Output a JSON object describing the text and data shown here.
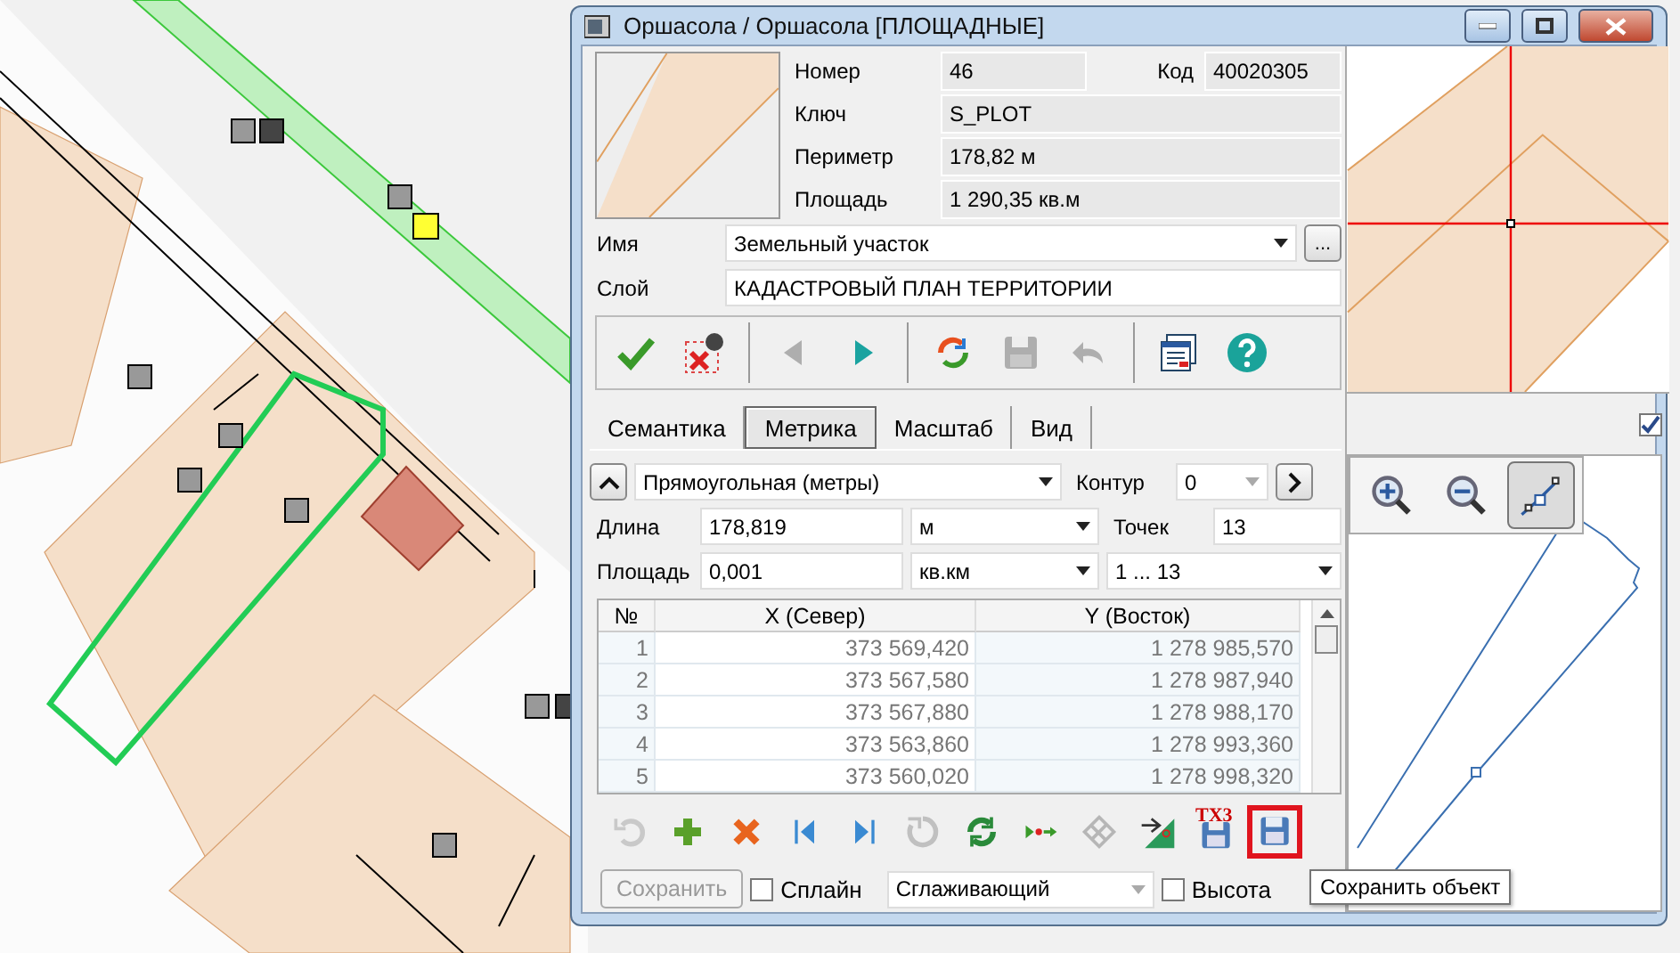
{
  "window": {
    "title": "Оршасола / Оршасола [ПЛОЩАДНЫЕ]"
  },
  "info": {
    "fields": [
      {
        "label": "Номер",
        "value": "46"
      },
      {
        "label": "Ключ",
        "value": "S_PLOT"
      },
      {
        "label": "Периметр",
        "value": "178,82 м"
      },
      {
        "label": "Площадь",
        "value": "1 290,35 кв.м"
      }
    ],
    "code": {
      "label": "Код",
      "value": "40020305"
    }
  },
  "name": {
    "label": "Имя",
    "value": "Земельный участок",
    "button": "..."
  },
  "layer": {
    "label": "Слой",
    "value": "КАДАСТРОВЫЙ ПЛАН ТЕРРИТОРИИ"
  },
  "toolbar": [
    [
      {
        "kind": "check",
        "disabled": false
      },
      {
        "kind": "cancel",
        "disabled": false
      }
    ],
    [
      {
        "kind": "prev",
        "disabled": true
      },
      {
        "kind": "next",
        "disabled": false
      }
    ],
    [
      {
        "kind": "refresh",
        "disabled": false
      },
      {
        "kind": "save",
        "disabled": true
      },
      {
        "kind": "undo",
        "disabled": true
      }
    ],
    [
      {
        "kind": "form",
        "disabled": false
      },
      {
        "kind": "help",
        "disabled": false
      }
    ]
  ],
  "tabs": [
    {
      "label": "Семантика",
      "selected": false
    },
    {
      "label": "Метрика",
      "selected": true
    },
    {
      "label": "Масштаб",
      "selected": false
    },
    {
      "label": "Вид",
      "selected": false
    }
  ],
  "tabs_checkbox": {
    "checked": true
  },
  "metric": {
    "system": "Прямоугольная (метры)",
    "contour": {
      "label": "Контур",
      "value": "0"
    },
    "length": {
      "label": "Длина",
      "value": "178,819",
      "unit": "м"
    },
    "points": {
      "label": "Точек",
      "value": "13"
    },
    "area": {
      "label": "Площадь",
      "value": "0,001",
      "unit": "кв.км"
    },
    "range": "1 ... 13"
  },
  "table": {
    "columns": [
      "№",
      "X (Север)",
      "Y (Восток)"
    ],
    "rows": [
      [
        "1",
        "373 569,420",
        "1 278 985,570"
      ],
      [
        "2",
        "373 567,580",
        "1 278 987,940"
      ],
      [
        "3",
        "373 567,880",
        "1 278 988,170"
      ],
      [
        "4",
        "373 563,860",
        "1 278 993,360"
      ],
      [
        "5",
        "373 560,020",
        "1 278 998,320"
      ]
    ]
  },
  "edit_toolbar": [
    {
      "kind": "undo",
      "disabled": true,
      "highlighted": false
    },
    {
      "kind": "add",
      "disabled": false,
      "highlighted": false
    },
    {
      "kind": "delete",
      "disabled": false,
      "highlighted": false
    },
    {
      "kind": "first",
      "disabled": false,
      "highlighted": false
    },
    {
      "kind": "last",
      "disabled": false,
      "highlighted": false
    },
    {
      "kind": "rotate",
      "disabled": true,
      "highlighted": false
    },
    {
      "kind": "refresh",
      "disabled": false,
      "highlighted": false
    },
    {
      "kind": "points",
      "disabled": false,
      "highlighted": false
    },
    {
      "kind": "diamond",
      "disabled": true,
      "highlighted": false
    },
    {
      "kind": "split",
      "disabled": false,
      "highlighted": false
    },
    {
      "kind": "textsave",
      "label": "TX3",
      "disabled": false,
      "highlighted": false
    },
    {
      "kind": "save",
      "disabled": false,
      "highlighted": true
    }
  ],
  "preview_tools": [
    {
      "kind": "zoom-in",
      "selected": false
    },
    {
      "kind": "zoom-out",
      "selected": false
    },
    {
      "kind": "edit-line",
      "selected": true
    }
  ],
  "footer": {
    "save_button": {
      "label": "Сохранить",
      "disabled": true
    },
    "spline": {
      "label": "Сплайн",
      "checked": false
    },
    "smoothing": "Сглаживающий",
    "height": {
      "label": "Высота",
      "checked": false
    }
  },
  "tooltip": "Сохранить объект"
}
